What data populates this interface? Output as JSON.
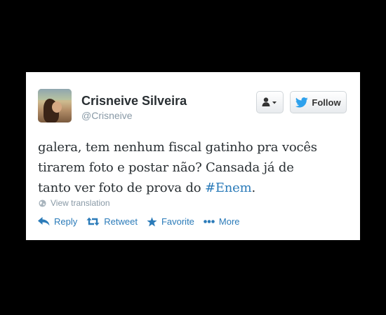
{
  "tweet": {
    "display_name": "Crisneive Silveira",
    "handle": "@Crisneive",
    "text_lines": [
      "galera, tem nenhum fiscal gatinho pra vocês",
      "tirarem foto e postar não? Cansada já de",
      "tanto ver foto de prova do "
    ],
    "hashtag": "#Enem",
    "text_end": ".",
    "view_translation": "View translation"
  },
  "buttons": {
    "follow_label": "Follow",
    "user_menu_icon": "user-dropdown-icon",
    "twitter_bird_icon": "twitter-bird-icon"
  },
  "actions": [
    {
      "label": "Reply",
      "icon": "reply-icon"
    },
    {
      "label": "Retweet",
      "icon": "retweet-icon"
    },
    {
      "label": "Favorite",
      "icon": "star-icon"
    },
    {
      "label": "More",
      "icon": "more-dots-icon"
    }
  ],
  "colors": {
    "background": "#000000",
    "card": "#ffffff",
    "link": "#2b7bb9",
    "text": "#292f33",
    "muted": "#8899a6"
  }
}
